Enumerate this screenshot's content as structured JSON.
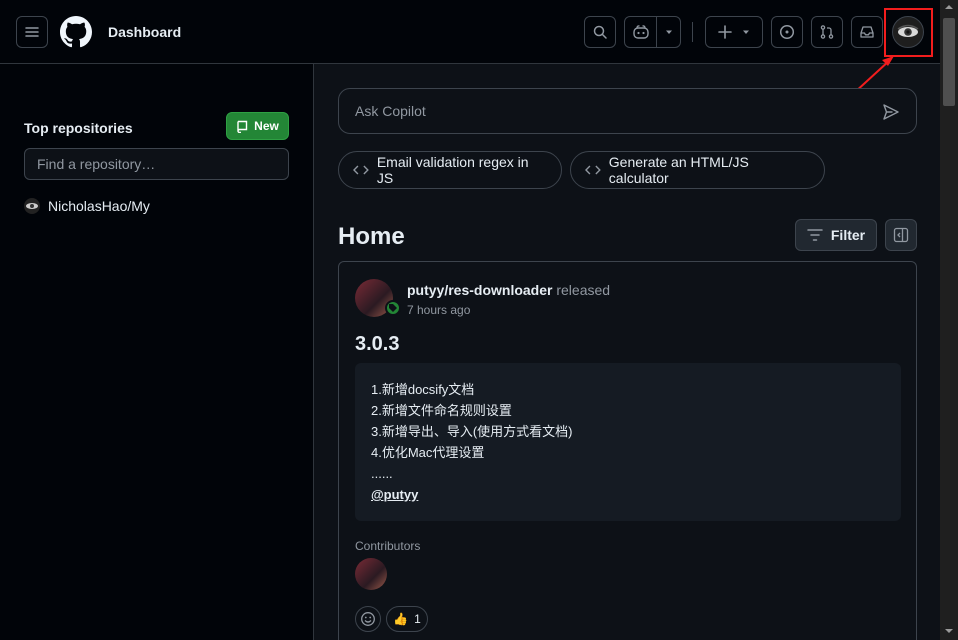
{
  "header": {
    "title": "Dashboard",
    "icons": {
      "menu": "hamburger-menu-icon",
      "logo": "github-logo-icon",
      "search": "search-icon",
      "copilot": "copilot-icon",
      "copilot_dropdown": "chevron-down-icon",
      "create": "plus-icon",
      "create_dropdown": "chevron-down-icon",
      "issues": "issue-opened-icon",
      "pull_requests": "git-pull-request-icon",
      "inbox": "inbox-icon",
      "avatar": "user-avatar-eye"
    }
  },
  "sidebar": {
    "heading": "Top repositories",
    "new_button": "New",
    "search_placeholder": "Find a repository…",
    "repositories": [
      {
        "name": "NicholasHao/My"
      }
    ]
  },
  "copilot": {
    "placeholder": "Ask Copilot",
    "suggestions": [
      {
        "label": "Email validation regex in JS"
      },
      {
        "label": "Generate an HTML/JS calculator"
      }
    ]
  },
  "feed": {
    "title": "Home",
    "filter_label": "Filter",
    "card": {
      "repo": "putyy/res-downloader",
      "action": "released",
      "time": "7 hours ago",
      "version": "3.0.3",
      "notes": [
        "1.新增docsify文档",
        "2.新增文件命名规则设置",
        "3.新增导出、导入(使用方式看文档)",
        "4.优化Mac代理设置",
        "......"
      ],
      "mention": "@putyy",
      "contributors_label": "Contributors",
      "reactions": {
        "add_icon": "smiley-icon",
        "thumbs_up_emoji": "👍",
        "thumbs_up_count": "1"
      }
    }
  },
  "colors": {
    "background": "#0d1117",
    "header_bg": "#010409",
    "border": "#3d444d",
    "new_button": "#238636",
    "highlight_box": "#f21d1d"
  }
}
